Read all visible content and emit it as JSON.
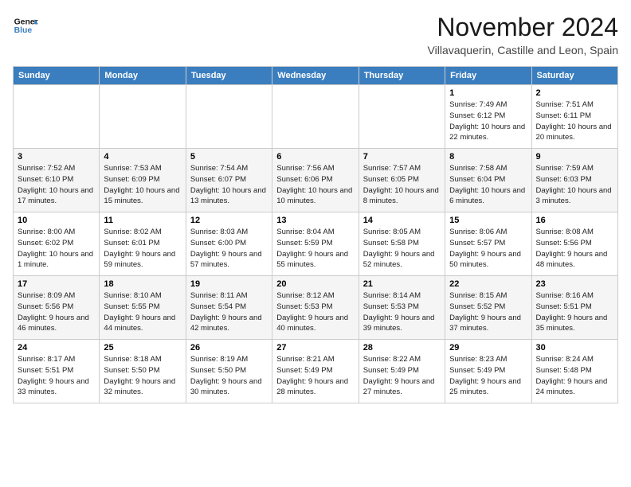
{
  "logo": {
    "line1": "General",
    "line2": "Blue"
  },
  "title": "November 2024",
  "location": "Villavaquerin, Castille and Leon, Spain",
  "weekdays": [
    "Sunday",
    "Monday",
    "Tuesday",
    "Wednesday",
    "Thursday",
    "Friday",
    "Saturday"
  ],
  "weeks": [
    [
      {
        "day": "",
        "info": ""
      },
      {
        "day": "",
        "info": ""
      },
      {
        "day": "",
        "info": ""
      },
      {
        "day": "",
        "info": ""
      },
      {
        "day": "",
        "info": ""
      },
      {
        "day": "1",
        "info": "Sunrise: 7:49 AM\nSunset: 6:12 PM\nDaylight: 10 hours and 22 minutes."
      },
      {
        "day": "2",
        "info": "Sunrise: 7:51 AM\nSunset: 6:11 PM\nDaylight: 10 hours and 20 minutes."
      }
    ],
    [
      {
        "day": "3",
        "info": "Sunrise: 7:52 AM\nSunset: 6:10 PM\nDaylight: 10 hours and 17 minutes."
      },
      {
        "day": "4",
        "info": "Sunrise: 7:53 AM\nSunset: 6:09 PM\nDaylight: 10 hours and 15 minutes."
      },
      {
        "day": "5",
        "info": "Sunrise: 7:54 AM\nSunset: 6:07 PM\nDaylight: 10 hours and 13 minutes."
      },
      {
        "day": "6",
        "info": "Sunrise: 7:56 AM\nSunset: 6:06 PM\nDaylight: 10 hours and 10 minutes."
      },
      {
        "day": "7",
        "info": "Sunrise: 7:57 AM\nSunset: 6:05 PM\nDaylight: 10 hours and 8 minutes."
      },
      {
        "day": "8",
        "info": "Sunrise: 7:58 AM\nSunset: 6:04 PM\nDaylight: 10 hours and 6 minutes."
      },
      {
        "day": "9",
        "info": "Sunrise: 7:59 AM\nSunset: 6:03 PM\nDaylight: 10 hours and 3 minutes."
      }
    ],
    [
      {
        "day": "10",
        "info": "Sunrise: 8:00 AM\nSunset: 6:02 PM\nDaylight: 10 hours and 1 minute."
      },
      {
        "day": "11",
        "info": "Sunrise: 8:02 AM\nSunset: 6:01 PM\nDaylight: 9 hours and 59 minutes."
      },
      {
        "day": "12",
        "info": "Sunrise: 8:03 AM\nSunset: 6:00 PM\nDaylight: 9 hours and 57 minutes."
      },
      {
        "day": "13",
        "info": "Sunrise: 8:04 AM\nSunset: 5:59 PM\nDaylight: 9 hours and 55 minutes."
      },
      {
        "day": "14",
        "info": "Sunrise: 8:05 AM\nSunset: 5:58 PM\nDaylight: 9 hours and 52 minutes."
      },
      {
        "day": "15",
        "info": "Sunrise: 8:06 AM\nSunset: 5:57 PM\nDaylight: 9 hours and 50 minutes."
      },
      {
        "day": "16",
        "info": "Sunrise: 8:08 AM\nSunset: 5:56 PM\nDaylight: 9 hours and 48 minutes."
      }
    ],
    [
      {
        "day": "17",
        "info": "Sunrise: 8:09 AM\nSunset: 5:56 PM\nDaylight: 9 hours and 46 minutes."
      },
      {
        "day": "18",
        "info": "Sunrise: 8:10 AM\nSunset: 5:55 PM\nDaylight: 9 hours and 44 minutes."
      },
      {
        "day": "19",
        "info": "Sunrise: 8:11 AM\nSunset: 5:54 PM\nDaylight: 9 hours and 42 minutes."
      },
      {
        "day": "20",
        "info": "Sunrise: 8:12 AM\nSunset: 5:53 PM\nDaylight: 9 hours and 40 minutes."
      },
      {
        "day": "21",
        "info": "Sunrise: 8:14 AM\nSunset: 5:53 PM\nDaylight: 9 hours and 39 minutes."
      },
      {
        "day": "22",
        "info": "Sunrise: 8:15 AM\nSunset: 5:52 PM\nDaylight: 9 hours and 37 minutes."
      },
      {
        "day": "23",
        "info": "Sunrise: 8:16 AM\nSunset: 5:51 PM\nDaylight: 9 hours and 35 minutes."
      }
    ],
    [
      {
        "day": "24",
        "info": "Sunrise: 8:17 AM\nSunset: 5:51 PM\nDaylight: 9 hours and 33 minutes."
      },
      {
        "day": "25",
        "info": "Sunrise: 8:18 AM\nSunset: 5:50 PM\nDaylight: 9 hours and 32 minutes."
      },
      {
        "day": "26",
        "info": "Sunrise: 8:19 AM\nSunset: 5:50 PM\nDaylight: 9 hours and 30 minutes."
      },
      {
        "day": "27",
        "info": "Sunrise: 8:21 AM\nSunset: 5:49 PM\nDaylight: 9 hours and 28 minutes."
      },
      {
        "day": "28",
        "info": "Sunrise: 8:22 AM\nSunset: 5:49 PM\nDaylight: 9 hours and 27 minutes."
      },
      {
        "day": "29",
        "info": "Sunrise: 8:23 AM\nSunset: 5:49 PM\nDaylight: 9 hours and 25 minutes."
      },
      {
        "day": "30",
        "info": "Sunrise: 8:24 AM\nSunset: 5:48 PM\nDaylight: 9 hours and 24 minutes."
      }
    ]
  ]
}
